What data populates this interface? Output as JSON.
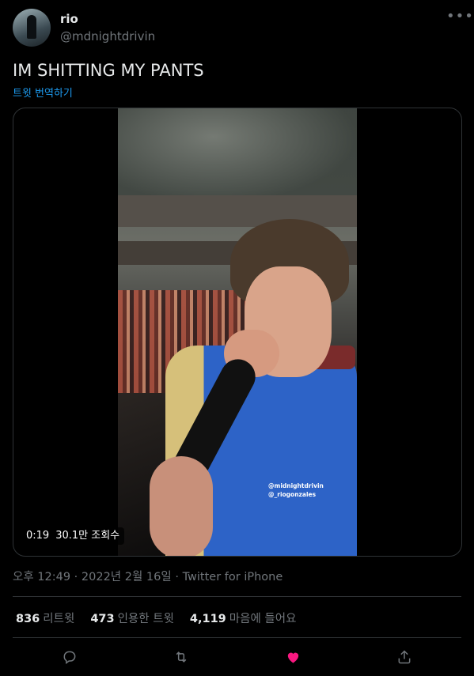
{
  "user": {
    "name": "rio",
    "handle": "@mdnightdrivin"
  },
  "more_icon": "more-horizontal-icon",
  "tweet": {
    "text": "IM SHITTING MY PANTS",
    "translate_label": "트윗 번역하기"
  },
  "video": {
    "watermark_line1": "@midnightdrivin",
    "watermark_line2": "@_riogonzales",
    "duration": "0:19",
    "views": "30.1만 조회수"
  },
  "meta": {
    "time": "오후 12:49",
    "date": "2022년 2월 16일",
    "source": "Twitter for iPhone",
    "separator": " · "
  },
  "stats": {
    "retweets": "836",
    "retweets_label": "리트윗",
    "quotes": "473",
    "quotes_label": "인용한 트윗",
    "likes": "4,119",
    "likes_label": "마음에 들어요"
  },
  "actions": {
    "reply_icon": "reply-icon",
    "retweet_icon": "retweet-icon",
    "like_icon": "heart-icon",
    "share_icon": "share-icon",
    "like_color": "#f91880",
    "icon_color": "#71767b"
  },
  "colors": {
    "background": "#000000",
    "text": "#e7e9ea",
    "secondary": "#71767b",
    "link": "#1d9bf0",
    "border": "#2f3336"
  }
}
